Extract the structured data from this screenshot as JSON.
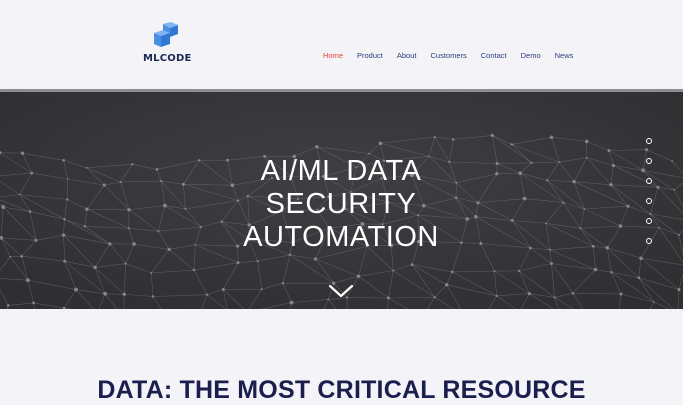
{
  "brand": {
    "name": "MLCODE",
    "logo_color": "#4a90e2"
  },
  "nav": {
    "items": [
      {
        "label": "Home",
        "active": true
      },
      {
        "label": "Product",
        "active": false
      },
      {
        "label": "About",
        "active": false
      },
      {
        "label": "Customers",
        "active": false
      },
      {
        "label": "Contact",
        "active": false
      },
      {
        "label": "Demo",
        "active": false
      },
      {
        "label": "News",
        "active": false
      }
    ],
    "active_color": "#e8403a",
    "link_color": "#2c3e7a"
  },
  "hero": {
    "title_lines": [
      "AI/ML DATA",
      "SECURITY",
      "AUTOMATION"
    ],
    "scroll_icon": "chevron-down-icon",
    "slide_dots": 6
  },
  "section": {
    "heading": "DATA: THE MOST CRITICAL RESOURCE"
  }
}
